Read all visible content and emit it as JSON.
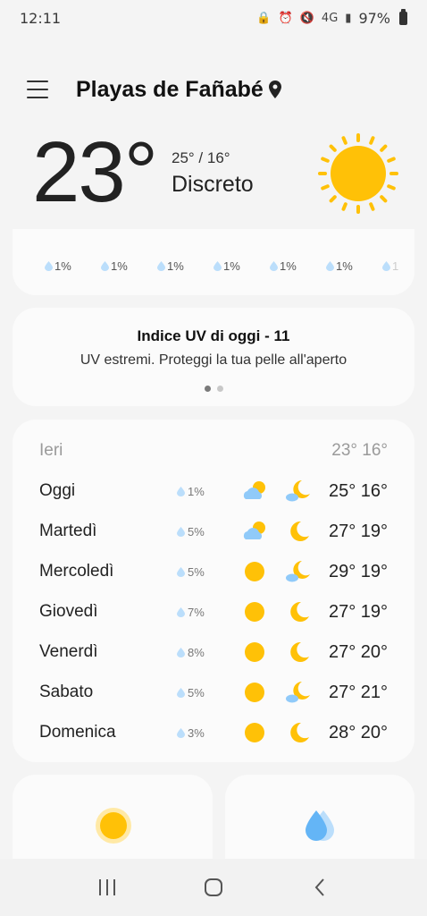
{
  "status": {
    "time": "12:11",
    "battery": "97%",
    "network": "4G"
  },
  "header": {
    "location": "Playas de Fañabé"
  },
  "current": {
    "temperature": "23°",
    "hilo": "25° / 16°",
    "condition": "Discreto",
    "icon": "sun-icon"
  },
  "hourly": [
    {
      "precip": "1%"
    },
    {
      "precip": "1%"
    },
    {
      "precip": "1%"
    },
    {
      "precip": "1%"
    },
    {
      "precip": "1%"
    },
    {
      "precip": "1%"
    },
    {
      "precip": "1"
    }
  ],
  "uv": {
    "title": "Indice UV di oggi - 11",
    "text": "UV estremi. Proteggi la tua pelle all'aperto"
  },
  "daily": {
    "yesterday": {
      "label": "Ieri",
      "temps": "23° 16°"
    },
    "days": [
      {
        "name": "Oggi",
        "precip": "1%",
        "day_icon": "partly-cloudy-icon",
        "night_icon": "cloudy-moon-icon",
        "temps": "25° 16°"
      },
      {
        "name": "Martedì",
        "precip": "5%",
        "day_icon": "partly-cloudy-icon",
        "night_icon": "moon-icon",
        "temps": "27° 19°"
      },
      {
        "name": "Mercoledì",
        "precip": "5%",
        "day_icon": "sun-icon",
        "night_icon": "cloudy-moon-icon",
        "temps": "29° 19°"
      },
      {
        "name": "Giovedì",
        "precip": "7%",
        "day_icon": "sun-icon",
        "night_icon": "moon-icon",
        "temps": "27° 19°"
      },
      {
        "name": "Venerdì",
        "precip": "8%",
        "day_icon": "sun-icon",
        "night_icon": "moon-icon",
        "temps": "27° 20°"
      },
      {
        "name": "Sabato",
        "precip": "5%",
        "day_icon": "sun-icon",
        "night_icon": "cloudy-moon-icon",
        "temps": "27° 21°"
      },
      {
        "name": "Domenica",
        "precip": "3%",
        "day_icon": "sun-icon",
        "night_icon": "moon-icon",
        "temps": "28° 20°"
      }
    ]
  },
  "colors": {
    "sun": "#FFC107",
    "drop": "#BBDEFB",
    "cloud": "#90CAF9"
  }
}
